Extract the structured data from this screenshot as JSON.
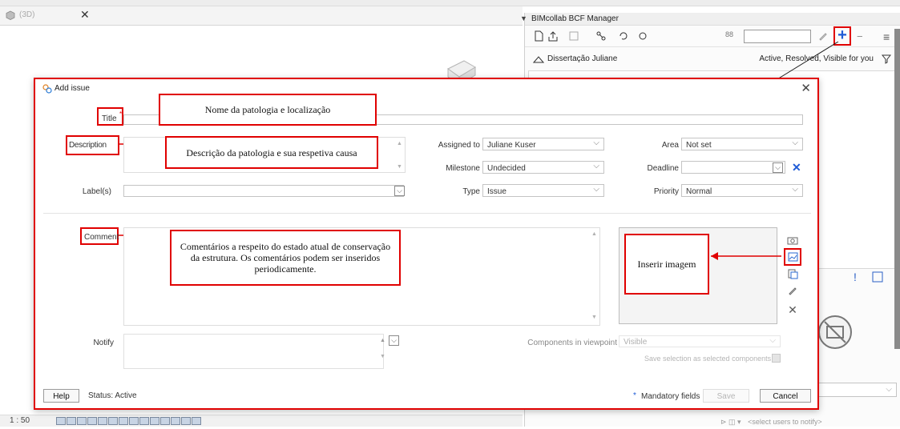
{
  "app": {
    "view_tab_label": "(3D)",
    "view_tab_close": "✕",
    "scale_label": "1 : 50",
    "bcf_panel_title": "BIMcollab BCF Manager",
    "bcf_search_value": "",
    "bcf_add_label": "+",
    "bcf_remove_label": "−",
    "bcf_menu_label": "≡",
    "bcf_count_icon": "88",
    "project_name": "Dissertação Juliane",
    "issue_filter": "Active, Resolved, Visible for you",
    "side_alert": "!",
    "notify_placeholder": "<select users to notify>"
  },
  "dialog": {
    "title": "Add issue",
    "close": "✕",
    "fields": {
      "title_label": "Title",
      "title_required": "*",
      "title_value": "",
      "description_label": "Description",
      "labels_label": "Label(s)",
      "assigned_to_label": "Assigned to",
      "assigned_to_value": "Juliane Kuser",
      "milestone_label": "Milestone",
      "milestone_value": "Undecided",
      "type_label": "Type",
      "type_value": "Issue",
      "area_label": "Area",
      "area_value": "Not set",
      "deadline_label": "Deadline",
      "deadline_value": "",
      "deadline_clear": "✕",
      "priority_label": "Priority",
      "priority_value": "Normal",
      "comment_label": "Comment",
      "notify_label": "Notify",
      "components_label": "Components in viewpoint",
      "components_value": "Visible",
      "save_selection_label": "Save selection as selected components"
    },
    "footer": {
      "help": "Help",
      "status": "Status: Active",
      "mandatory": "Mandatory fields",
      "mandatory_mark": "*",
      "save": "Save",
      "cancel": "Cancel"
    }
  },
  "annotations": {
    "title_note": "Nome da patologia e localização",
    "description_note": "Descrição da patologia e sua respetiva causa",
    "comment_note": "Comentários a respeito do estado atual de conservação da estrutura. Os comentários podem ser inseridos periodicamente.",
    "image_note": "Inserir imagem"
  },
  "colors": {
    "annotation_red": "#e00000",
    "accent_blue": "#1e5bd6"
  }
}
